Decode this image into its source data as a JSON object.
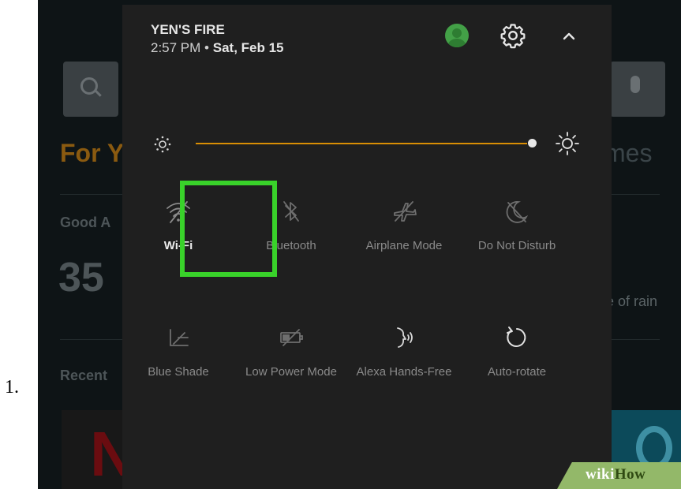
{
  "list_number": "1.",
  "background": {
    "for_text": "For Y",
    "right_text": "mes",
    "greeting": "Good A",
    "temperature": "35",
    "rain_text": "e of rain",
    "recent": "Recent",
    "netflix_letter": "N"
  },
  "header": {
    "device_name": "YEN'S FIRE",
    "time": "2:57 PM",
    "separator": "•",
    "date": "Sat, Feb 15"
  },
  "brightness": {
    "level": 1.0
  },
  "quick_settings": [
    {
      "label": "Wi-Fi",
      "icon": "wifi-off-icon",
      "active": true
    },
    {
      "label": "Bluetooth",
      "icon": "bluetooth-off-icon",
      "active": false
    },
    {
      "label": "Airplane Mode",
      "icon": "airplane-off-icon",
      "active": false
    },
    {
      "label": "Do Not Disturb",
      "icon": "moon-off-icon",
      "active": false
    },
    {
      "label": "Blue Shade",
      "icon": "blue-shade-icon",
      "active": false
    },
    {
      "label": "Low Power Mode",
      "icon": "battery-off-icon",
      "active": false
    },
    {
      "label": "Alexa Hands-Free",
      "icon": "alexa-voice-icon",
      "active": false
    },
    {
      "label": "Auto-rotate",
      "icon": "rotate-icon",
      "active": false
    }
  ],
  "watermark": {
    "part1": "wiki",
    "part2": "How"
  },
  "colors": {
    "panel": "#1f1f1f",
    "accent": "#d98e04",
    "highlight": "#39d22a",
    "avatar": "#43a047"
  }
}
